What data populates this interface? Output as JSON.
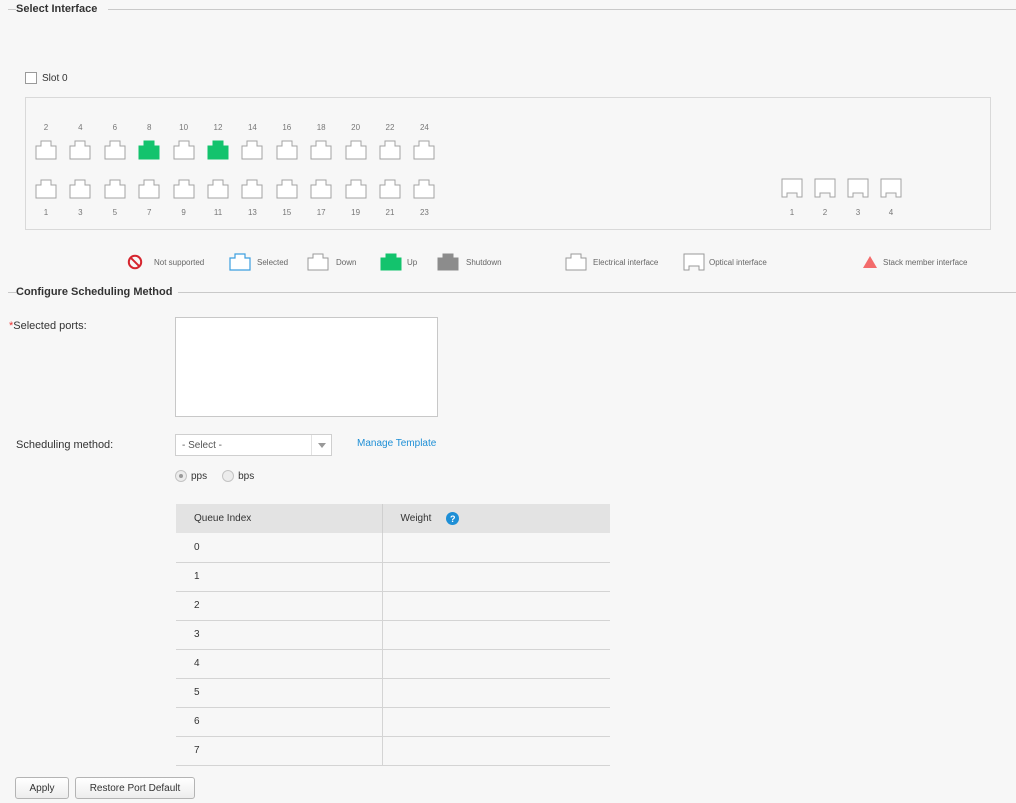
{
  "select_interface": {
    "title": "Select Interface",
    "slot_label": "Slot 0",
    "top_ports": [
      {
        "label": "2",
        "status": "down"
      },
      {
        "label": "4",
        "status": "down"
      },
      {
        "label": "6",
        "status": "down"
      },
      {
        "label": "8",
        "status": "up"
      },
      {
        "label": "10",
        "status": "down"
      },
      {
        "label": "12",
        "status": "up"
      },
      {
        "label": "14",
        "status": "down"
      },
      {
        "label": "16",
        "status": "down"
      },
      {
        "label": "18",
        "status": "down"
      },
      {
        "label": "20",
        "status": "down"
      },
      {
        "label": "22",
        "status": "down"
      },
      {
        "label": "24",
        "status": "down"
      }
    ],
    "bottom_ports": [
      {
        "label": "1",
        "status": "down"
      },
      {
        "label": "3",
        "status": "down"
      },
      {
        "label": "5",
        "status": "down"
      },
      {
        "label": "7",
        "status": "down"
      },
      {
        "label": "9",
        "status": "down"
      },
      {
        "label": "11",
        "status": "down"
      },
      {
        "label": "13",
        "status": "down"
      },
      {
        "label": "15",
        "status": "down"
      },
      {
        "label": "17",
        "status": "down"
      },
      {
        "label": "19",
        "status": "down"
      },
      {
        "label": "21",
        "status": "down"
      },
      {
        "label": "23",
        "status": "down"
      }
    ],
    "optical_ports": [
      {
        "label": "1",
        "status": "down"
      },
      {
        "label": "2",
        "status": "down"
      },
      {
        "label": "3",
        "status": "down"
      },
      {
        "label": "4",
        "status": "down"
      }
    ]
  },
  "legend": {
    "not_supported": "Not supported",
    "selected": "Selected",
    "down": "Down",
    "up": "Up",
    "shutdown": "Shutdown",
    "electrical": "Electrical interface",
    "optical": "Optical interface",
    "stack_member": "Stack member interface"
  },
  "configure": {
    "title": "Configure Scheduling Method",
    "selected_ports_label": "Selected ports:",
    "selected_ports_value": "",
    "scheduling_method_label": "Scheduling method:",
    "scheduling_method_value": "- Select -",
    "manage_template": "Manage Template",
    "radio_pps": "pps",
    "radio_bps": "bps",
    "radio_selected": "pps",
    "table": {
      "headers": [
        "Queue Index",
        "Weight"
      ],
      "rows": [
        {
          "queue": "0",
          "weight": ""
        },
        {
          "queue": "1",
          "weight": ""
        },
        {
          "queue": "2",
          "weight": ""
        },
        {
          "queue": "3",
          "weight": ""
        },
        {
          "queue": "4",
          "weight": ""
        },
        {
          "queue": "5",
          "weight": ""
        },
        {
          "queue": "6",
          "weight": ""
        },
        {
          "queue": "7",
          "weight": ""
        }
      ]
    }
  },
  "buttons": {
    "apply": "Apply",
    "restore": "Restore Port Default"
  },
  "colors": {
    "up": "#13c36d",
    "selected": "#3d9fe0",
    "shutdown": "#8c8c8c",
    "not_supported": "#d6262f",
    "stack_member": "#f36b6b",
    "link": "#1e8fd6"
  },
  "icons": {
    "help": "?"
  }
}
